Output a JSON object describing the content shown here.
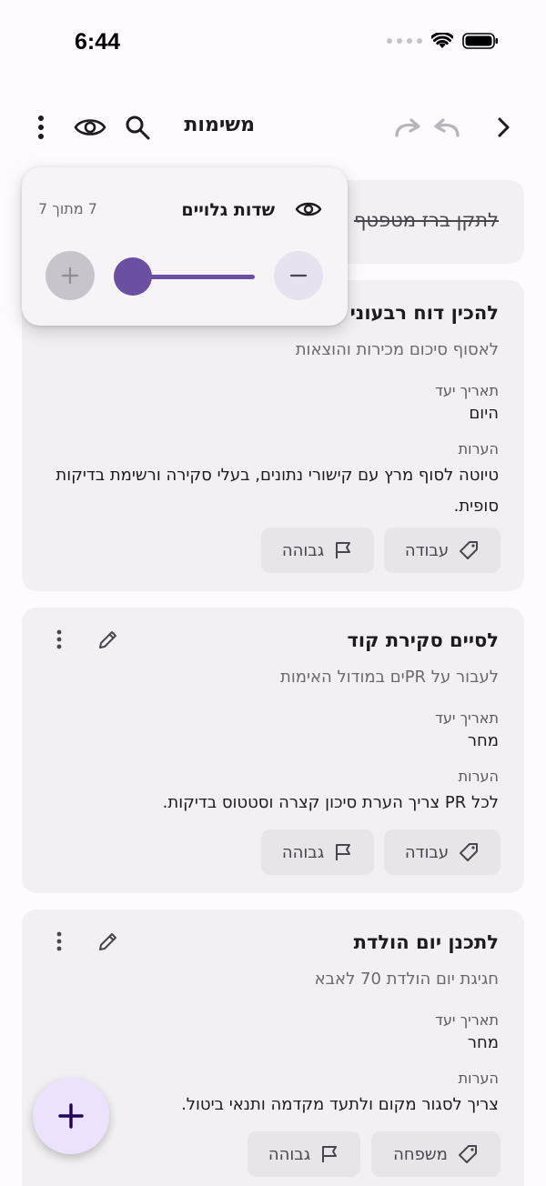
{
  "status": {
    "time": "6:44"
  },
  "toolbar": {
    "title": "משימות"
  },
  "popup": {
    "title": "שדות גלויים",
    "count": "7 מתוך 7",
    "slider_fraction": 1.0
  },
  "tasks": [
    {
      "title": "לתקן ברז מטפטף",
      "completed": true
    },
    {
      "title": "להכין דוח רבעוני",
      "subtitle": "לאסוף סיכום מכירות והוצאות",
      "due_label": "תאריך יעד",
      "due_value": "היום",
      "notes_label": "הערות",
      "notes_value": "טיוטה לסוף מרץ עם קישורי נתונים, בעלי סקירה ורשימת בדיקות סופית.",
      "tag": "עבודה",
      "priority": "גבוהה"
    },
    {
      "title": "לסיים סקירת קוד",
      "subtitle": "לעבור על PRים במודול האימות",
      "due_label": "תאריך יעד",
      "due_value": "מחר",
      "notes_label": "הערות",
      "notes_value": "לכל PR צריך הערת סיכון קצרה וסטטוס בדיקות.",
      "tag": "עבודה",
      "priority": "גבוהה"
    },
    {
      "title": "לתכנן יום הולדת",
      "subtitle": "חגיגת יום הולדת 70 לאבא",
      "due_label": "תאריך יעד",
      "due_value": "מחר",
      "notes_label": "הערות",
      "notes_value": "צריך לסגור מקום ולתעד מקדמה ותנאי ביטול.",
      "tag": "משפחה",
      "priority": "גבוהה"
    }
  ],
  "colors": {
    "accent": "#6a4fa3",
    "card_bg": "#f3f0f4",
    "fab_bg": "#ece2fb"
  }
}
